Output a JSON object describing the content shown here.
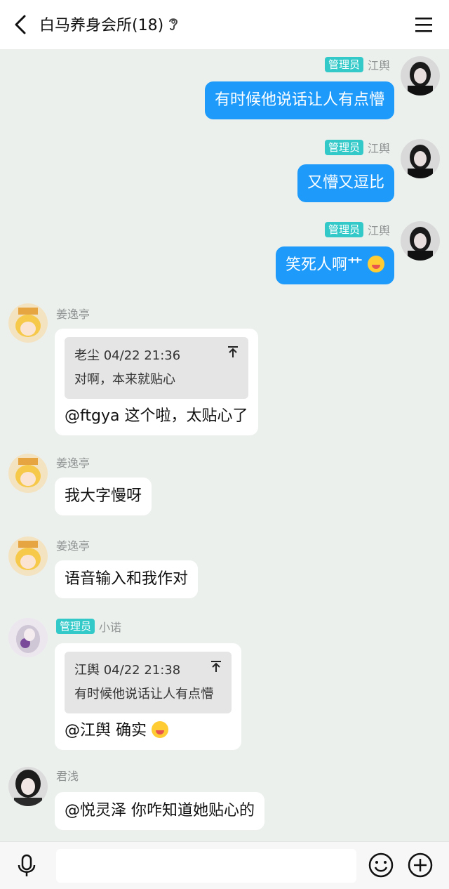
{
  "header": {
    "title": "白马养身会所(18)",
    "back_icon": "chevron-left-icon",
    "ear_icon": "ear-icon",
    "menu_icon": "hamburger-menu-icon"
  },
  "colors": {
    "my_bubble": "#1e9bfa",
    "other_bubble": "#ffffff",
    "admin_badge": "#34c9c9",
    "background": "#ebf0ed"
  },
  "messages": [
    {
      "sender": "江舆",
      "badge": "管理员",
      "text": "有时候他说话让人有点懵",
      "mine": true
    },
    {
      "sender": "江舆",
      "badge": "管理员",
      "text": "又懵又逗比",
      "mine": true
    },
    {
      "sender": "江舆",
      "badge": "管理员",
      "text": "笑死人啊艹",
      "emoji": "laughing-emoji",
      "mine": true
    },
    {
      "sender": "姜逸亭",
      "quote": {
        "author_time": "老尘 04/22 21:36",
        "text": "对啊，本来就贴心"
      },
      "text": "@ftgya 这个啦，太贴心了",
      "mine": false
    },
    {
      "sender": "姜逸亭",
      "text": "我大字慢呀",
      "mine": false
    },
    {
      "sender": "姜逸亭",
      "text": "语音输入和我作对",
      "mine": false
    },
    {
      "sender": "小诺",
      "badge": "管理员",
      "quote": {
        "author_time": "江舆 04/22 21:38",
        "text": "有时候他说话让人有点懵"
      },
      "text": "@江舆 确实",
      "emoji": "laughing-emoji",
      "mine": false
    },
    {
      "sender": "君浅",
      "text": "@悦灵泽 你咋知道她贴心的",
      "mine": false
    }
  ],
  "input_bar": {
    "mic_icon": "microphone-icon",
    "emoji_icon": "smiley-icon",
    "plus_icon": "plus-circle-icon",
    "placeholder": ""
  }
}
